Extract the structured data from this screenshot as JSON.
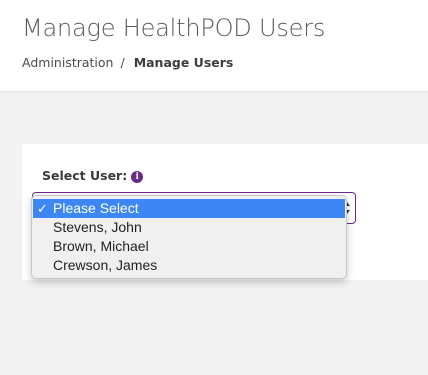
{
  "page": {
    "title": "Manage HealthPOD Users"
  },
  "breadcrumb": {
    "items": [
      "Administration",
      "Manage Users"
    ],
    "separator": "/"
  },
  "form": {
    "select_user_label": "Select User:",
    "info_icon": "info-icon",
    "select": {
      "selected_value": "Please Select",
      "options": [
        {
          "label": "Please Select",
          "selected": true
        },
        {
          "label": "Stevens, John",
          "selected": false
        },
        {
          "label": "Brown, Michael",
          "selected": false
        },
        {
          "label": "Crewson, James",
          "selected": false
        }
      ],
      "check_glyph": "✓"
    }
  },
  "colors": {
    "accent": "#6a2a8a",
    "selection": "#3d87f5",
    "background": "#f2f2f2"
  }
}
